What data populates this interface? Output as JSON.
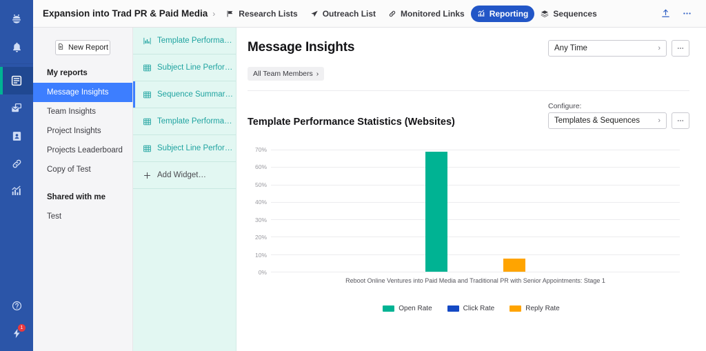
{
  "rail": {
    "items": [
      {
        "name": "logo-icon",
        "label": "Logo"
      },
      {
        "name": "notifications-icon",
        "label": "Notifications"
      },
      {
        "name": "reports-icon",
        "label": "Reports"
      },
      {
        "name": "inbox-icon",
        "label": "Inbox"
      },
      {
        "name": "contacts-icon",
        "label": "Contacts"
      },
      {
        "name": "links-icon",
        "label": "Monitored Links"
      },
      {
        "name": "analytics-icon",
        "label": "Analytics"
      }
    ],
    "bottom": [
      {
        "name": "help-icon",
        "label": "Help"
      },
      {
        "name": "whats-new-icon",
        "label": "What's New",
        "badge": "1"
      }
    ]
  },
  "topbar": {
    "project_title": "Expansion into Trad PR & Paid Media",
    "separator": "›",
    "nav": [
      {
        "label": "Research Lists",
        "icon": "flag-icon",
        "active": false
      },
      {
        "label": "Outreach List",
        "icon": "send-icon",
        "active": false
      },
      {
        "label": "Monitored Links",
        "icon": "link-icon",
        "active": false
      },
      {
        "label": "Reporting",
        "icon": "bar-chart-icon",
        "active": true
      },
      {
        "label": "Sequences",
        "icon": "layers-icon",
        "active": false
      }
    ],
    "actions": [
      {
        "name": "upload-icon",
        "label": "Upload"
      },
      {
        "name": "more-options-icon",
        "label": "More"
      }
    ]
  },
  "reports_sidebar": {
    "new_report_label": "New Report",
    "my_reports_heading": "My reports",
    "my_reports": [
      {
        "label": "Message Insights",
        "active": true
      },
      {
        "label": "Team Insights",
        "active": false
      },
      {
        "label": "Project Insights",
        "active": false
      },
      {
        "label": "Projects Leaderboard",
        "active": false
      },
      {
        "label": "Copy of Test",
        "active": false
      }
    ],
    "shared_heading": "Shared with me",
    "shared": [
      {
        "label": "Test",
        "active": false
      }
    ]
  },
  "widgets_panel": {
    "items": [
      {
        "label": "Template Performanc…",
        "icon": "bar-chart-icon",
        "selected": false
      },
      {
        "label": "Subject Line Perform…",
        "icon": "table-icon",
        "selected": false
      },
      {
        "label": "Sequence Summary …",
        "icon": "table-icon",
        "selected": true
      },
      {
        "label": "Template Performanc…",
        "icon": "table-icon",
        "selected": false
      },
      {
        "label": "Subject Line Perform…",
        "icon": "table-icon",
        "selected": false
      }
    ],
    "add_widget_label": "Add Widget…",
    "add_widget_icon": "plus-icon"
  },
  "main": {
    "page_title": "Message Insights",
    "time_filter": {
      "value": "Any Time",
      "chevron": "›"
    },
    "team_chip": {
      "label": "All Team Members",
      "chevron": "›"
    },
    "panel_title": "Template Performance Statistics (Websites)",
    "configure_label": "Configure:",
    "configure_select": {
      "value": "Templates & Sequences",
      "chevron": "›"
    },
    "kebab_glyph": "•••"
  },
  "chart_data": {
    "type": "bar",
    "title": "Template Performance Statistics (Websites)",
    "categories": [
      "Reboot Online Ventures into Paid Media and Traditional PR with Senior Appointments: Stage 1"
    ],
    "xlabel": "Reboot Online Ventures into Paid Media and Traditional PR with Senior Appointments: Stage 1",
    "ylabel": "",
    "ylim": [
      0,
      70
    ],
    "yticks": [
      70,
      60,
      50,
      40,
      30,
      20,
      10,
      0
    ],
    "ytick_labels": [
      "70%",
      "60%",
      "50%",
      "40%",
      "30%",
      "20%",
      "10%",
      "0%"
    ],
    "grid": true,
    "legend_position": "bottom",
    "series": [
      {
        "name": "Open Rate",
        "color": "#00b393",
        "values": [
          69
        ]
      },
      {
        "name": "Click Rate",
        "color": "#1449c4",
        "values": [
          0
        ]
      },
      {
        "name": "Reply Rate",
        "color": "#ffa400",
        "values": [
          7.5
        ]
      }
    ]
  },
  "colors": {
    "rail_bg": "#2B55A8",
    "accent_blue": "#3d7eff",
    "nav_active": "#2256c7",
    "widget_panel_bg": "#e2f7f2",
    "widget_text": "#1fa3a0",
    "open_rate": "#00b393",
    "click_rate": "#1449c4",
    "reply_rate": "#ffa400"
  }
}
